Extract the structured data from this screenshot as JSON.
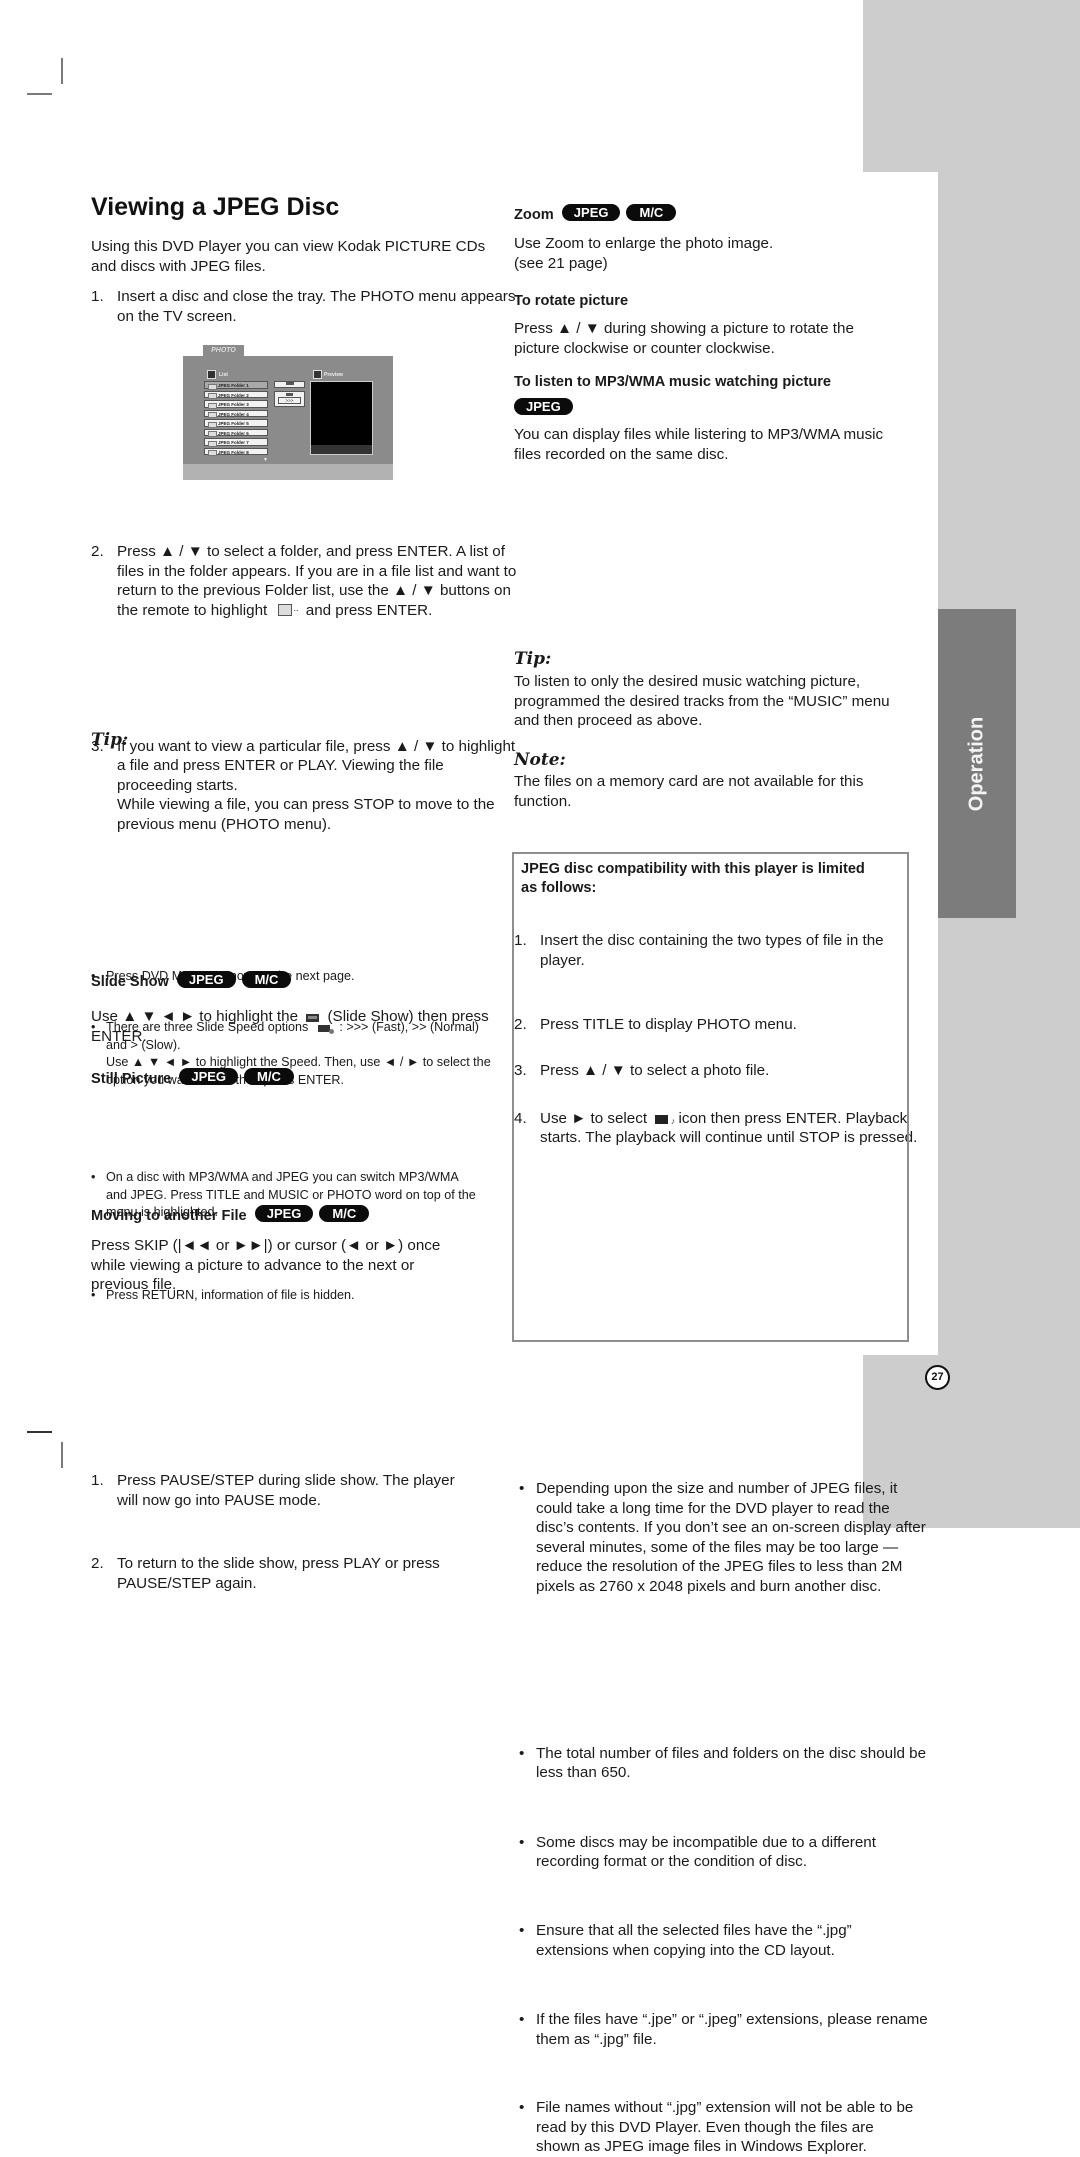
{
  "page": {
    "title": "Viewing a JPEG Disc",
    "section_tab": "Operation",
    "page_number": "27"
  },
  "left": {
    "intro": "Using this DVD Player you can view Kodak PICTURE CDs and discs with JPEG files.",
    "steps": [
      {
        "n": "1.",
        "text": "Insert a disc and close the tray. The PHOTO menu appears on the TV screen."
      },
      {
        "n": "2.",
        "text_a": "Press ▲ / ▼ to select a folder, and press ENTER. A list of files in the folder appears. If you are in a file list and want to return to the previous Folder list, use the ▲ / ▼ buttons on the remote to highlight",
        "text_b": "and press ENTER."
      },
      {
        "n": "3.",
        "text_a": "If you want to view a particular file, press ▲ / ▼ to highlight a file and press ENTER or PLAY. Viewing the file proceeding starts.",
        "text_b": "While viewing a file, you can press STOP to move to the previous menu (PHOTO menu)."
      }
    ],
    "photo_menu": {
      "tab": "PHOTO",
      "list_label": "List",
      "preview_label": "Preview",
      "folders": [
        "JPEG Folder 1",
        "JPEG Folder 2",
        "JPEG Folder 3",
        "JPEG Folder 4",
        "JPEG Folder 5",
        "JPEG Folder 6",
        "JPEG Folder 7",
        "JPEG Folder 8"
      ],
      "selected_index": 0,
      "speed_value": ">>>"
    },
    "tip": {
      "heading": "Tip:",
      "items": [
        "Press DVD MENU to move to the next page.",
        "There are three Slide Speed options",
        "On a disc with MP3/WMA and JPEG you can switch MP3/WMA and JPEG. Press TITLE and MUSIC or PHOTO word on top of the menu is highlighted.",
        "Press RETURN, information of file is hidden."
      ],
      "speed_rest": ": >>> (Fast), >> (Normal) and > (Slow).",
      "speed_use": "Use ▲ ▼ ◄ ► to highlight the Speed. Then, use ◄ / ► to select the option you want to use then press ENTER."
    },
    "slide_show": {
      "heading": "Slide Show",
      "text_a": "Use ▲ ▼ ◄ ► to highlight the",
      "text_b": "(Slide Show) then press ENTER."
    },
    "still_picture": {
      "heading": "Still Picture",
      "steps": [
        {
          "n": "1.",
          "text": "Press PAUSE/STEP during slide show. The player will now go into PAUSE mode."
        },
        {
          "n": "2.",
          "text": "To return to the slide show, press PLAY or press PAUSE/STEP again."
        }
      ]
    },
    "moving": {
      "heading": "Moving to another File",
      "text": "Press SKIP (|◄◄ or ►►|) or cursor (◄ or ►) once while viewing a picture to advance to the next or previous file."
    }
  },
  "badges": {
    "jpeg": "JPEG",
    "mc": "M/C"
  },
  "right": {
    "zoom": {
      "heading": "Zoom",
      "text": "Use Zoom to enlarge the photo image.",
      "see": "(see 21 page)"
    },
    "rotate": {
      "heading": "To rotate picture",
      "text": "Press ▲ / ▼ during showing a picture to rotate the picture clockwise or counter clockwise."
    },
    "listen": {
      "heading": "To listen to MP3/WMA music watching picture",
      "text": "You can display files while listering to MP3/WMA music files recorded on the same disc.",
      "steps": [
        {
          "n": "1.",
          "text": "Insert the disc containing the two types of file in the player."
        },
        {
          "n": "2.",
          "text": "Press TITLE to display PHOTO menu."
        },
        {
          "n": "3.",
          "text": "Press ▲ / ▼ to select a photo file."
        },
        {
          "n": "4.",
          "text_a": "Use ► to select",
          "text_b": "icon then press ENTER. Playback starts. The playback will continue until STOP is pressed."
        }
      ]
    },
    "tip": {
      "heading": "Tip:",
      "text": "To listen to only the desired music watching picture, programmed the desired tracks from the “MUSIC” menu and then proceed as above."
    },
    "note": {
      "heading": "Note:",
      "text": "The files on a memory card are not available for this function."
    },
    "compat": {
      "heading": "JPEG disc compatibility with this player is limited as follows:",
      "items": [
        "Depending upon the size and number of JPEG files, it could take a long time for the DVD player to read the disc’s contents. If you don’t see an on-screen display after several minutes, some of the files may be too large — reduce the resolution of the JPEG files to less than 2M pixels as 2760 x 2048 pixels and burn another disc.",
        "The total number of files and folders on the disc should be less than 650.",
        "Some discs may be incompatible due to a different recording format or the condition of disc.",
        "Ensure that all the selected files have the “.jpg” extensions when copying into the CD layout.",
        "If the files have “.jpe” or “.jpeg” extensions, please rename them as “.jpg” file.",
        "File names without “.jpg” extension will not be able to be read by this DVD Player. Even though the files are shown as JPEG image files in Windows Explorer."
      ]
    }
  }
}
